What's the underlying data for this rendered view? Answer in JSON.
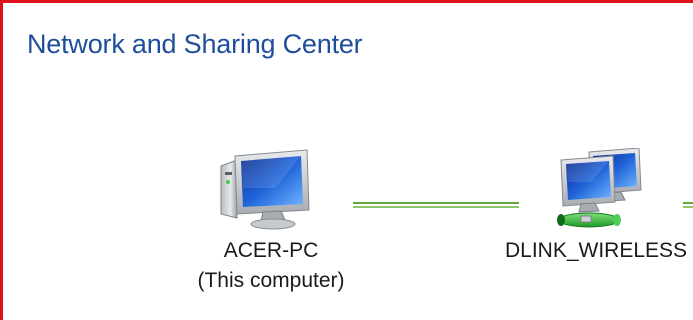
{
  "window": {
    "title": "Network and Sharing Center",
    "accent_color": "#1f4e9b",
    "highlight_border_color": "#e0101c"
  },
  "network_map": {
    "nodes": [
      {
        "name": "ACER-PC",
        "subtitle": "(This computer)",
        "icon": "computer-icon"
      },
      {
        "name": "DLINK_WIRELESS",
        "icon": "network-icon"
      }
    ],
    "connections": [
      {
        "type": "connected-line",
        "color": "#5fa83a"
      },
      {
        "type": "connected-line",
        "color": "#5fa83a"
      }
    ]
  }
}
